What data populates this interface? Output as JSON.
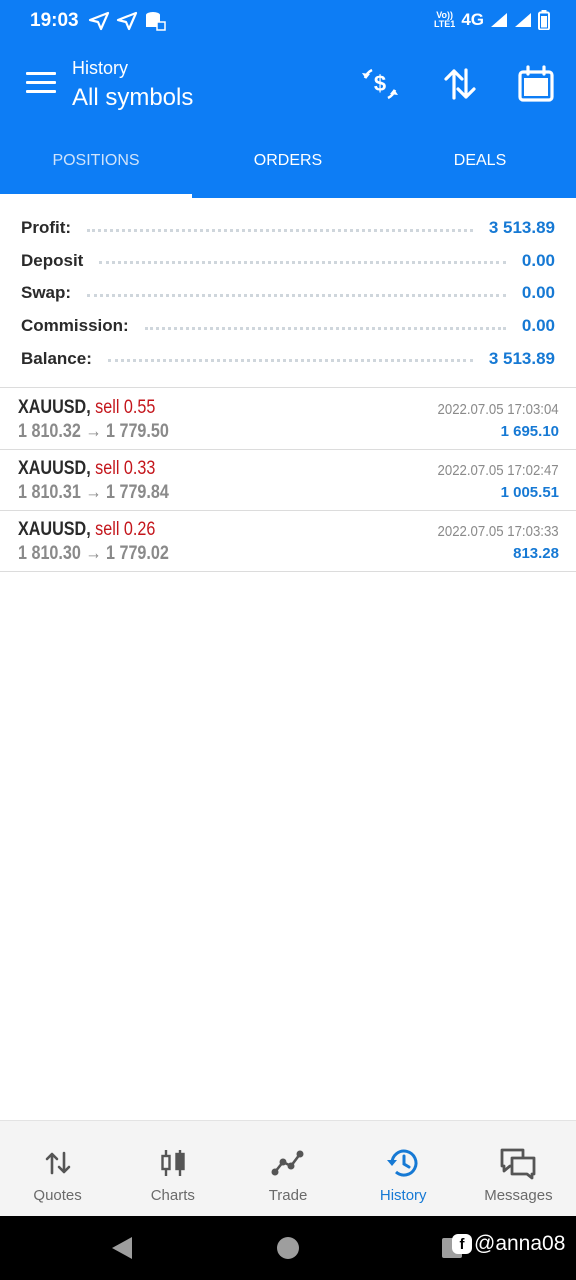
{
  "status_bar": {
    "time": "19:03",
    "volte": "Vo))\nLTE1",
    "network": "4G"
  },
  "app_bar": {
    "title": "History",
    "subtitle": "All symbols",
    "actions": [
      "currency-exchange-icon",
      "sort-icon",
      "calendar-icon"
    ]
  },
  "tabs": [
    {
      "label": "POSITIONS",
      "active": true
    },
    {
      "label": "ORDERS",
      "active": false
    },
    {
      "label": "DEALS",
      "active": false
    }
  ],
  "summary": {
    "profit": {
      "label": "Profit:",
      "value": "3 513.89"
    },
    "deposit": {
      "label": "Deposit",
      "value": "0.00"
    },
    "swap": {
      "label": "Swap:",
      "value": "0.00"
    },
    "commission": {
      "label": "Commission:",
      "value": "0.00"
    },
    "balance": {
      "label": "Balance:",
      "value": "3 513.89"
    }
  },
  "deals": [
    {
      "symbol": "XAUUSD,",
      "side": "sell 0.55",
      "prices": "1 810.32 → 1 779.50",
      "time": "2022.07.05 17:03:04",
      "profit": "1 695.10"
    },
    {
      "symbol": "XAUUSD,",
      "side": "sell 0.33",
      "prices": "1 810.31 → 1 779.84",
      "time": "2022.07.05 17:02:47",
      "profit": "1 005.51"
    },
    {
      "symbol": "XAUUSD,",
      "side": "sell 0.26",
      "prices": "1 810.30 → 1 779.02",
      "time": "2022.07.05 17:03:33",
      "profit": "813.28"
    }
  ],
  "bottom_nav": [
    {
      "label": "Quotes",
      "icon": "quotes-icon",
      "active": false
    },
    {
      "label": "Charts",
      "icon": "charts-icon",
      "active": false
    },
    {
      "label": "Trade",
      "icon": "trade-icon",
      "active": false
    },
    {
      "label": "History",
      "icon": "history-icon",
      "active": true
    },
    {
      "label": "Messages",
      "icon": "messages-icon",
      "active": false
    }
  ],
  "watermark": {
    "logo": "f",
    "handle": "@anna08"
  },
  "colors": {
    "primary": "#0d7df5",
    "accent_blue": "#1679d4",
    "sell_red": "#c4161c",
    "muted_gray": "#8a8a8a"
  }
}
